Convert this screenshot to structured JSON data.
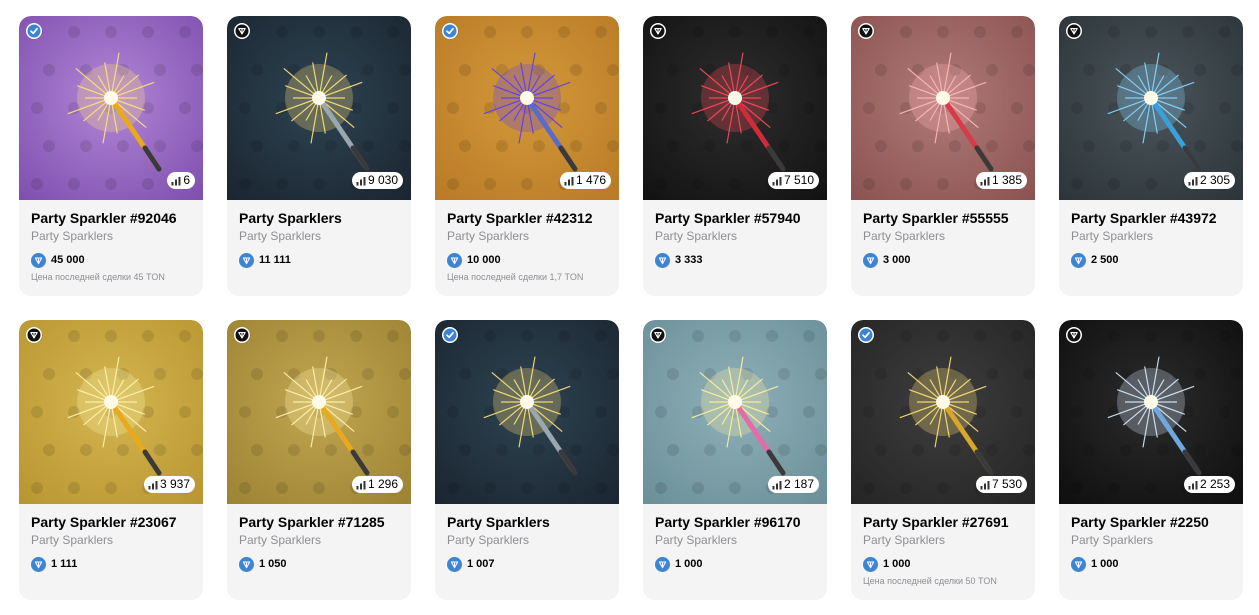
{
  "cards": [
    {
      "title": "Party Sparkler #92046",
      "collection": "Party Sparklers",
      "count": "6",
      "price": "45 000",
      "last_deal": "Цена последней сделки 45 TON",
      "badge": "blue-check-icon",
      "bg": [
        "#b186d6",
        "#7e4fae"
      ],
      "stick": "#e8a91a",
      "spark": "#ffe27a"
    },
    {
      "title": "Party Sparklers",
      "collection": "Party Sparklers",
      "count": "9 030",
      "price": "11 111",
      "last_deal": "",
      "badge": "black-ton-icon",
      "bg": [
        "#2f4452",
        "#1a2530"
      ],
      "stick": "#9aa6b0",
      "spark": "#ffe27a"
    },
    {
      "title": "Party Sparkler #42312",
      "collection": "Party Sparklers",
      "count": "1 476",
      "price": "10 000",
      "last_deal": "Цена последней сделки 1,7 TON",
      "badge": "blue-check-icon",
      "bg": [
        "#d4993a",
        "#b87a26"
      ],
      "stick": "#5a6cc9",
      "spark": "#5a3cf5"
    },
    {
      "title": "Party Sparkler #57940",
      "collection": "Party Sparklers",
      "count": "7 510",
      "price": "3 333",
      "last_deal": "",
      "badge": "black-ton-icon",
      "bg": [
        "#2e2e2e",
        "#121212"
      ],
      "stick": "#d12a3a",
      "spark": "#ff4a5a"
    },
    {
      "title": "Party Sparkler #55555",
      "collection": "Party Sparklers",
      "count": "1 385",
      "price": "3 000",
      "last_deal": "",
      "badge": "black-ton-icon",
      "bg": [
        "#b07a78",
        "#8a5350"
      ],
      "stick": "#d83a4a",
      "spark": "#ffb8b8"
    },
    {
      "title": "Party Sparkler #43972",
      "collection": "Party Sparklers",
      "count": "2 305",
      "price": "2 500",
      "last_deal": "",
      "badge": "black-ton-icon",
      "bg": [
        "#4a555c",
        "#2c3438"
      ],
      "stick": "#3aa0dc",
      "spark": "#8ad8ff"
    },
    {
      "title": "Party Sparkler #23067",
      "collection": "Party Sparklers",
      "count": "3 937",
      "price": "1 111",
      "last_deal": "",
      "badge": "black-ton-icon",
      "bg": [
        "#d4b650",
        "#b89530"
      ],
      "stick": "#e8a91a",
      "spark": "#fff3b0"
    },
    {
      "title": "Party Sparkler #71285",
      "collection": "Party Sparklers",
      "count": "1 296",
      "price": "1 050",
      "last_deal": "",
      "badge": "black-ton-icon",
      "bg": [
        "#c2a650",
        "#9c8234"
      ],
      "stick": "#e8a91a",
      "spark": "#fff3b0"
    },
    {
      "title": "Party Sparklers",
      "collection": "Party Sparklers",
      "count": "",
      "price": "1 007",
      "last_deal": "",
      "badge": "blue-check-icon",
      "bg": [
        "#2f4452",
        "#1a2530"
      ],
      "stick": "#9aa6b0",
      "spark": "#ffe27a"
    },
    {
      "title": "Party Sparkler #96170",
      "collection": "Party Sparklers",
      "count": "2 187",
      "price": "1 000",
      "last_deal": "",
      "badge": "black-ton-icon",
      "bg": [
        "#8fb0b8",
        "#6a8f98"
      ],
      "stick": "#e46aa8",
      "spark": "#fff0a0"
    },
    {
      "title": "Party Sparkler #27691",
      "collection": "Party Sparklers",
      "count": "7 530",
      "price": "1 000",
      "last_deal": "Цена последней сделки 50 TON",
      "badge": "blue-check-icon",
      "bg": [
        "#3e3e3e",
        "#242424"
      ],
      "stick": "#d9a52a",
      "spark": "#ffe27a"
    },
    {
      "title": "Party Sparkler #2250",
      "collection": "Party Sparklers",
      "count": "2 253",
      "price": "1 000",
      "last_deal": "",
      "badge": "black-ton-icon",
      "bg": [
        "#2c2c2c",
        "#0e0e0e"
      ],
      "stick": "#6fa8e0",
      "spark": "#d8ecff"
    }
  ]
}
